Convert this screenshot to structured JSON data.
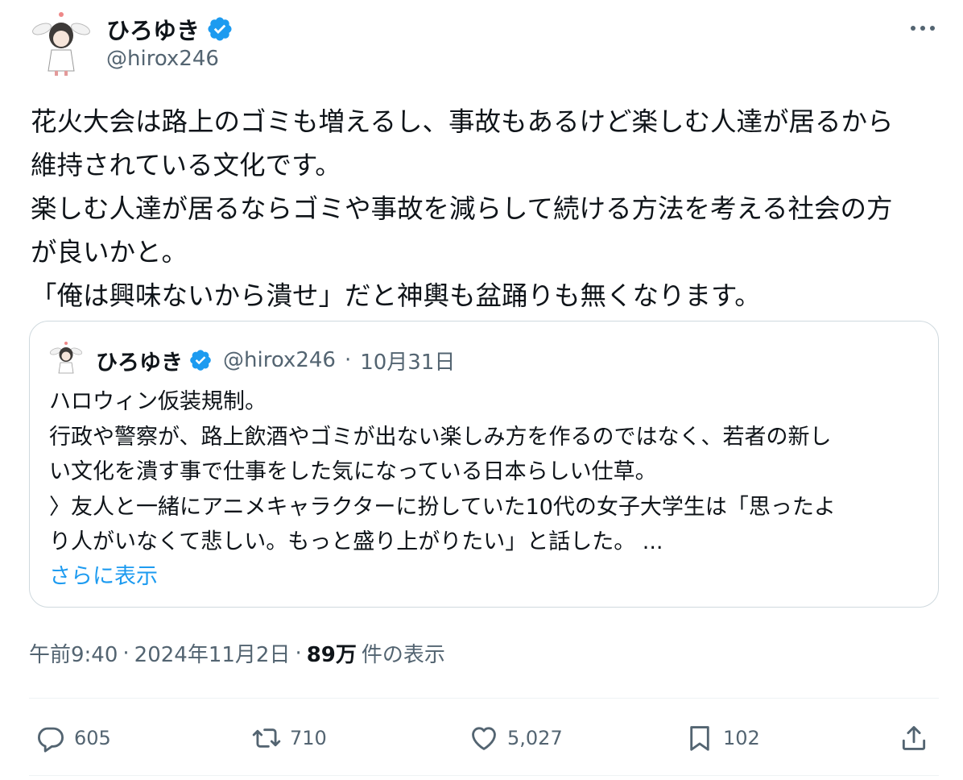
{
  "author": {
    "name": "ひろゆき",
    "handle": "@hirox246"
  },
  "tweet": {
    "text": "花火大会は路上のゴミも増えるし、事故もあるけど楽しむ人達が居るから\n維持されている文化です。\n楽しむ人達が居るならゴミや事故を減らして続ける方法を考える社会の方\nが良いかと。\n「俺は興味ないから潰せ」だと神輿も盆踊りも無くなります。"
  },
  "quote": {
    "name": "ひろゆき",
    "handle": "@hirox246",
    "separator": "·",
    "date": "10月31日",
    "text": "ハロウィン仮装規制。\n行政や警察が、路上飲酒やゴミが出ない楽しみ方を作るのではなく、若者の新し\nい文化を潰す事で仕事をした気になっている日本らしい仕草。\n〉友人と一緒にアニメキャラクターに扮していた10代の女子大学生は「思ったよ\nり人がいなくて悲しい。もっと盛り上がりたい」と話した。 ...",
    "show_more": "さらに表示"
  },
  "meta": {
    "time": "午前9:40",
    "sep1": "·",
    "date": "2024年11月2日",
    "sep2": "·",
    "views_count": "89万",
    "views_label": "件の表示"
  },
  "actions": {
    "replies": "605",
    "reposts": "710",
    "likes": "5,027",
    "bookmarks": "102"
  },
  "colors": {
    "accent": "#1d9bf0",
    "text": "#0f1419",
    "secondary": "#536471",
    "border": "#cfd9de"
  },
  "icons": [
    "verified-badge-icon",
    "more-icon",
    "reply-icon",
    "repost-icon",
    "like-icon",
    "bookmark-icon",
    "share-icon"
  ]
}
